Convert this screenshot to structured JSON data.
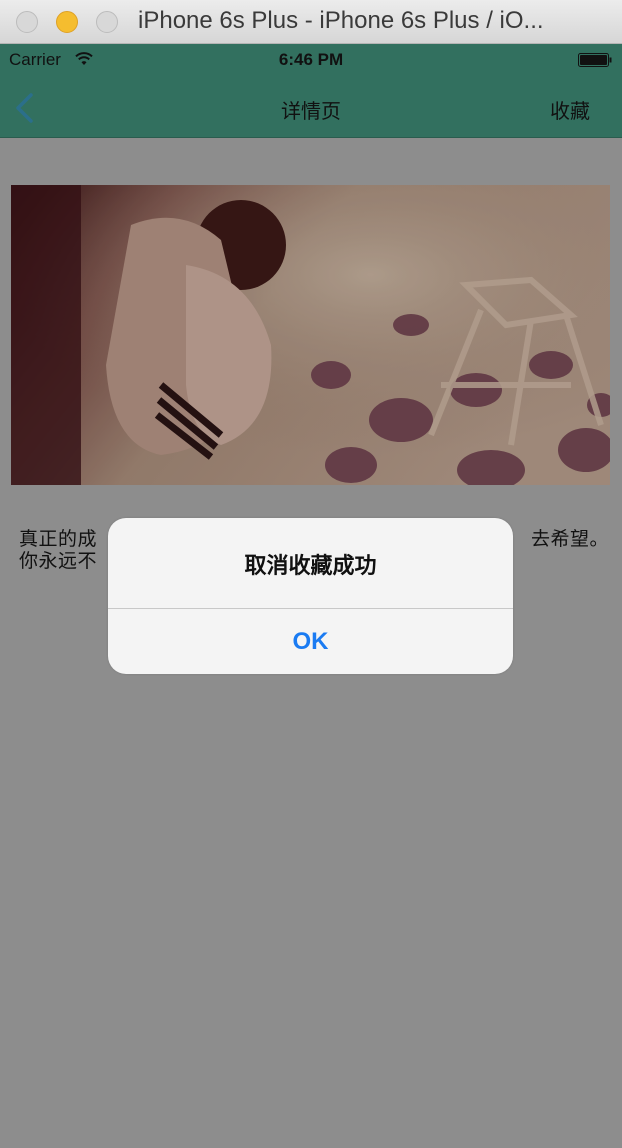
{
  "window": {
    "title": "iPhone 6s Plus - iPhone 6s Plus / iO..."
  },
  "status_bar": {
    "carrier": "Carrier",
    "time": "6:46 PM"
  },
  "nav_bar": {
    "title": "详情页",
    "right_button": "收藏",
    "background_color": "#32705f"
  },
  "content": {
    "text_line1_left": "真正的成",
    "text_line1_right": "去希望。",
    "text_line2_left": "你永远不"
  },
  "alert": {
    "title": "取消收藏成功",
    "button": "OK",
    "button_color": "#1a7bf2"
  }
}
